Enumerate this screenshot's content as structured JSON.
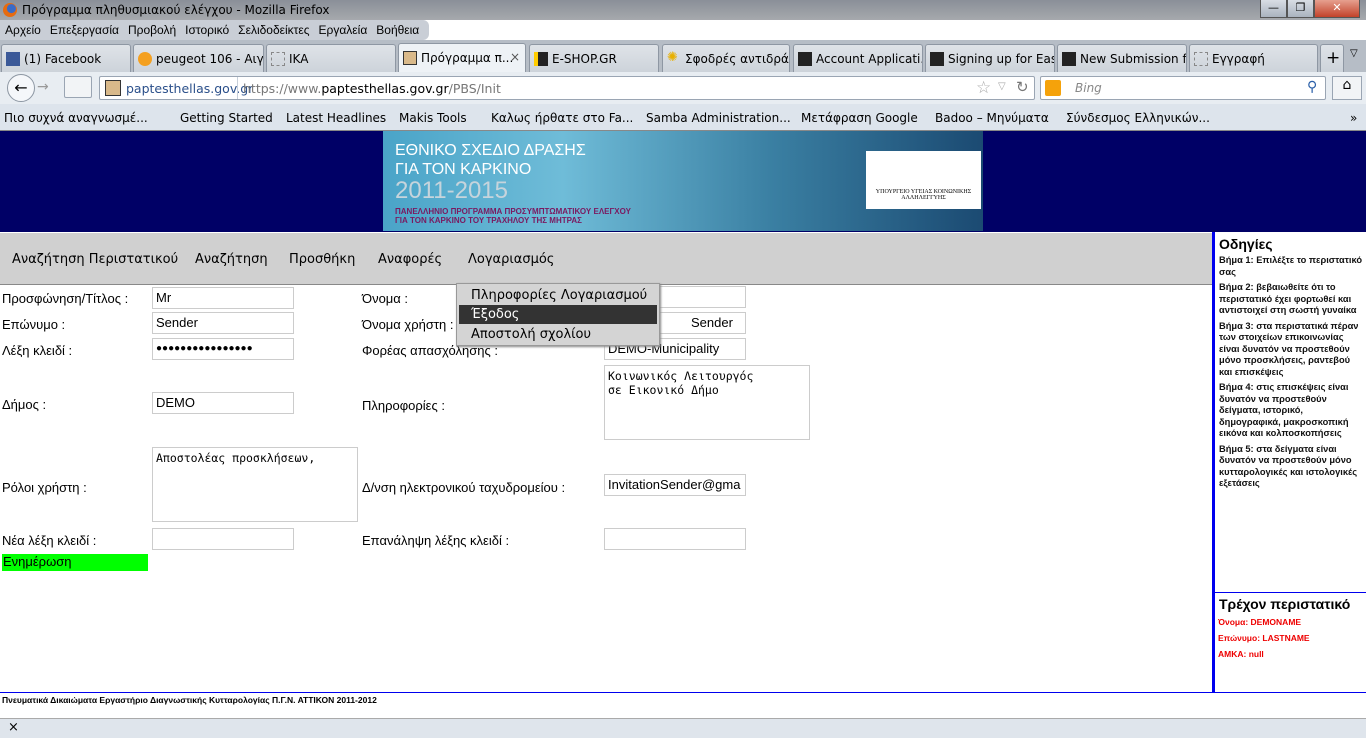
{
  "window": {
    "title": "Πρόγραμμα πληθυσμιακού ελέγχου - Mozilla Firefox",
    "min": "—",
    "max": "❐",
    "close": "✕"
  },
  "menu": [
    "Αρχείο",
    "Επεξεργασία",
    "Προβολή",
    "Ιστορικό",
    "Σελιδοδείκτες",
    "Εργαλεία",
    "Βοήθεια"
  ],
  "tabs": [
    {
      "label": "(1) Facebook"
    },
    {
      "label": "peugeot 106 - Αιγ..."
    },
    {
      "label": "IKA"
    },
    {
      "label": "Πρόγραμμα π...",
      "active": true
    },
    {
      "label": "E-SHOP.GR"
    },
    {
      "label": "Σφοδρές αντιδρά..."
    },
    {
      "label": "Account Applicati..."
    },
    {
      "label": "Signing up for Eas..."
    },
    {
      "label": "New Submission f..."
    },
    {
      "label": "Εγγραφή"
    }
  ],
  "tab_close": "×",
  "new_tab": "+",
  "nav": {
    "site": "paptesthellas.gov.gr",
    "url_prefix": "https://www.",
    "url_domain": "paptesthellas.gov.gr",
    "url_path": "/PBS/Init",
    "search_placeholder": "Bing"
  },
  "bookmarks": [
    "Πιο συχνά αναγνωσμέ...",
    "Getting Started",
    "Latest Headlines",
    "Makis Tools",
    "Καλως ήρθατε στο Fa...",
    "Samba Administration...",
    "Μετάφραση Google",
    "Badoo – Μηνύματα",
    "Σύνδεσμος Ελληνικών..."
  ],
  "banner": {
    "line1": "ΕΘΝΙΚΟ ΣΧΕΔΙΟ ΔΡΑΣΗΣ",
    "line2": "ΓΙΑ ΤΟΝ ΚΑΡΚΙΝΟ",
    "years": "2011-2015",
    "sub1": "ΠΑΝΕΛΛΗΝΙΟ ΠΡΟΓΡΑΜΜΑ ΠΡΟΣΥΜΠΤΩΜΑΤΙΚΟΥ ΕΛΕΓΧΟΥ",
    "sub2": "ΓΙΑ ΤΟΝ ΚΑΡΚΙΝΟ ΤΟΥ ΤΡΑΧΗΛΟΥ ΤΗΣ ΜΗΤΡΑΣ",
    "logo_text": "ΥΠΟΥΡΓΕΙΟ ΥΓΕΙΑΣ ΚΟΙΝΩΝΙΚΗΣ ΑΛΛΗΛΕΓΓΥΗΣ"
  },
  "navmenu": [
    "Αναζήτηση Περιστατικού",
    "Αναζήτηση",
    "Προσθήκη",
    "Αναφορές",
    "Λογαριασμός"
  ],
  "dropdown": [
    "Πληροφορίες Λογαριασμού",
    "Έξοδος",
    "Αποστολή σχολίου"
  ],
  "form": {
    "title_label": "Προσφώνηση/Τίτλος :",
    "title": "Mr",
    "lastname_label": "Επώνυμο :",
    "lastname": "Sender",
    "password_label": "Λέξη κλειδί :",
    "password": "●●●●●●●●●●●●●●●●",
    "municipality_label": "Δήμος :",
    "municipality": "DEMO",
    "roles_label": "Ρόλοι χρήστη :",
    "roles": "Αποστολέας προσκλήσεων,",
    "newpass_label": "Νέα λέξη κλειδί :",
    "newpass": "",
    "name_label": "Όνομα :",
    "name": "",
    "username_label": "Όνομα χρήστη :",
    "username": "Sender",
    "employer_label": "Φορέας απασχόλησης :",
    "employer": "DEMO-Municipality",
    "info_label": "Πληροφορίες :",
    "info": "Κοινωνικός Λειτουργός\nσε Εικονικό Δήμο",
    "email_label": "Δ/νση ηλεκτρονικού ταχυδρομείου :",
    "email": "InvitationSender@gma",
    "repeat_label": "Επανάληψη λέξης κλειδί :",
    "repeat": "",
    "update": "Ενημέρωση"
  },
  "sidebar": {
    "title": "Οδηγίες",
    "steps": [
      "Βήμα 1: Επιλέξτε το περιστατικό σας",
      "Βήμα 2: βεβαιωθείτε ότι το περιστατικό έχει φορτωθεί και αντιστοιχεί στη σωστή γυναίκα",
      "Βήμα 3: στα περιστατικά πέραν των στοιχείων επικοινωνίας είναι δυνατόν να προστεθούν μόνο προσκλήσεις, ραντεβού και επισκέψεις",
      "Βήμα 4: στις επισκέψεις είναι δυνατόν να προστεθούν δείγματα, ιστορικό, δημογραφικά, μακροσκοπική εικόνα και κολποσκοπήσεις",
      "Βήμα 5: στα δείγματα είναι δυνατόν να προστεθούν μόνο κυτταρολογικές και ιστολογικές εξετάσεις"
    ],
    "current_title": "Τρέχον περιστατικό",
    "current_name": "Όνομα: DEMONAME",
    "current_last": "Επώνυμο: LASTNAME",
    "current_amka": "ΑΜΚΑ: null"
  },
  "footer": "Πνευματικά Δικαιώματα Εργαστήριο Διαγνωστικής Κυτταρολογίας Π.Γ.Ν. ΑΤΤΙΚΟΝ 2011-2012",
  "status_close": "×"
}
